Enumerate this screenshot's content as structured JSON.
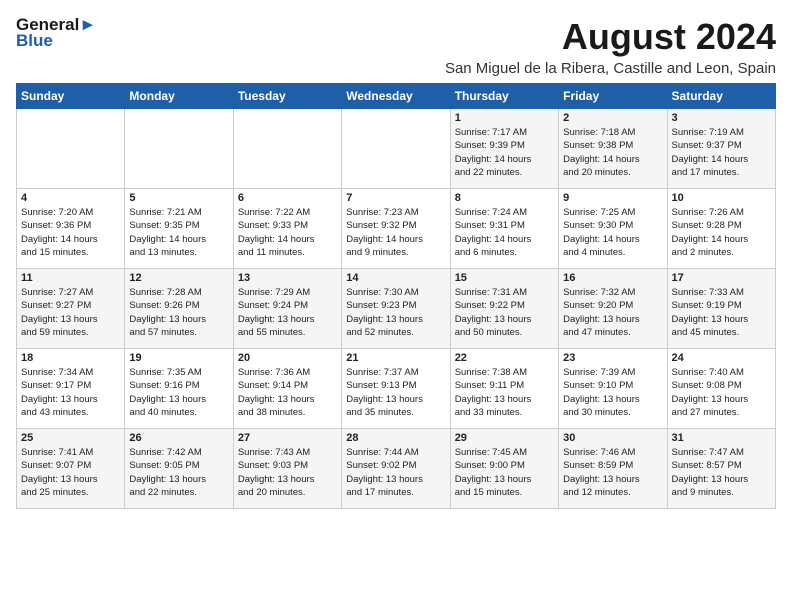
{
  "header": {
    "logo_line1": "General",
    "logo_line2": "Blue",
    "main_title": "August 2024",
    "subtitle": "San Miguel de la Ribera, Castille and Leon, Spain"
  },
  "calendar": {
    "weekdays": [
      "Sunday",
      "Monday",
      "Tuesday",
      "Wednesday",
      "Thursday",
      "Friday",
      "Saturday"
    ],
    "weeks": [
      [
        {
          "day": "",
          "info": ""
        },
        {
          "day": "",
          "info": ""
        },
        {
          "day": "",
          "info": ""
        },
        {
          "day": "",
          "info": ""
        },
        {
          "day": "1",
          "info": "Sunrise: 7:17 AM\nSunset: 9:39 PM\nDaylight: 14 hours\nand 22 minutes."
        },
        {
          "day": "2",
          "info": "Sunrise: 7:18 AM\nSunset: 9:38 PM\nDaylight: 14 hours\nand 20 minutes."
        },
        {
          "day": "3",
          "info": "Sunrise: 7:19 AM\nSunset: 9:37 PM\nDaylight: 14 hours\nand 17 minutes."
        }
      ],
      [
        {
          "day": "4",
          "info": "Sunrise: 7:20 AM\nSunset: 9:36 PM\nDaylight: 14 hours\nand 15 minutes."
        },
        {
          "day": "5",
          "info": "Sunrise: 7:21 AM\nSunset: 9:35 PM\nDaylight: 14 hours\nand 13 minutes."
        },
        {
          "day": "6",
          "info": "Sunrise: 7:22 AM\nSunset: 9:33 PM\nDaylight: 14 hours\nand 11 minutes."
        },
        {
          "day": "7",
          "info": "Sunrise: 7:23 AM\nSunset: 9:32 PM\nDaylight: 14 hours\nand 9 minutes."
        },
        {
          "day": "8",
          "info": "Sunrise: 7:24 AM\nSunset: 9:31 PM\nDaylight: 14 hours\nand 6 minutes."
        },
        {
          "day": "9",
          "info": "Sunrise: 7:25 AM\nSunset: 9:30 PM\nDaylight: 14 hours\nand 4 minutes."
        },
        {
          "day": "10",
          "info": "Sunrise: 7:26 AM\nSunset: 9:28 PM\nDaylight: 14 hours\nand 2 minutes."
        }
      ],
      [
        {
          "day": "11",
          "info": "Sunrise: 7:27 AM\nSunset: 9:27 PM\nDaylight: 13 hours\nand 59 minutes."
        },
        {
          "day": "12",
          "info": "Sunrise: 7:28 AM\nSunset: 9:26 PM\nDaylight: 13 hours\nand 57 minutes."
        },
        {
          "day": "13",
          "info": "Sunrise: 7:29 AM\nSunset: 9:24 PM\nDaylight: 13 hours\nand 55 minutes."
        },
        {
          "day": "14",
          "info": "Sunrise: 7:30 AM\nSunset: 9:23 PM\nDaylight: 13 hours\nand 52 minutes."
        },
        {
          "day": "15",
          "info": "Sunrise: 7:31 AM\nSunset: 9:22 PM\nDaylight: 13 hours\nand 50 minutes."
        },
        {
          "day": "16",
          "info": "Sunrise: 7:32 AM\nSunset: 9:20 PM\nDaylight: 13 hours\nand 47 minutes."
        },
        {
          "day": "17",
          "info": "Sunrise: 7:33 AM\nSunset: 9:19 PM\nDaylight: 13 hours\nand 45 minutes."
        }
      ],
      [
        {
          "day": "18",
          "info": "Sunrise: 7:34 AM\nSunset: 9:17 PM\nDaylight: 13 hours\nand 43 minutes."
        },
        {
          "day": "19",
          "info": "Sunrise: 7:35 AM\nSunset: 9:16 PM\nDaylight: 13 hours\nand 40 minutes."
        },
        {
          "day": "20",
          "info": "Sunrise: 7:36 AM\nSunset: 9:14 PM\nDaylight: 13 hours\nand 38 minutes."
        },
        {
          "day": "21",
          "info": "Sunrise: 7:37 AM\nSunset: 9:13 PM\nDaylight: 13 hours\nand 35 minutes."
        },
        {
          "day": "22",
          "info": "Sunrise: 7:38 AM\nSunset: 9:11 PM\nDaylight: 13 hours\nand 33 minutes."
        },
        {
          "day": "23",
          "info": "Sunrise: 7:39 AM\nSunset: 9:10 PM\nDaylight: 13 hours\nand 30 minutes."
        },
        {
          "day": "24",
          "info": "Sunrise: 7:40 AM\nSunset: 9:08 PM\nDaylight: 13 hours\nand 27 minutes."
        }
      ],
      [
        {
          "day": "25",
          "info": "Sunrise: 7:41 AM\nSunset: 9:07 PM\nDaylight: 13 hours\nand 25 minutes."
        },
        {
          "day": "26",
          "info": "Sunrise: 7:42 AM\nSunset: 9:05 PM\nDaylight: 13 hours\nand 22 minutes."
        },
        {
          "day": "27",
          "info": "Sunrise: 7:43 AM\nSunset: 9:03 PM\nDaylight: 13 hours\nand 20 minutes."
        },
        {
          "day": "28",
          "info": "Sunrise: 7:44 AM\nSunset: 9:02 PM\nDaylight: 13 hours\nand 17 minutes."
        },
        {
          "day": "29",
          "info": "Sunrise: 7:45 AM\nSunset: 9:00 PM\nDaylight: 13 hours\nand 15 minutes."
        },
        {
          "day": "30",
          "info": "Sunrise: 7:46 AM\nSunset: 8:59 PM\nDaylight: 13 hours\nand 12 minutes."
        },
        {
          "day": "31",
          "info": "Sunrise: 7:47 AM\nSunset: 8:57 PM\nDaylight: 13 hours\nand 9 minutes."
        }
      ]
    ]
  }
}
